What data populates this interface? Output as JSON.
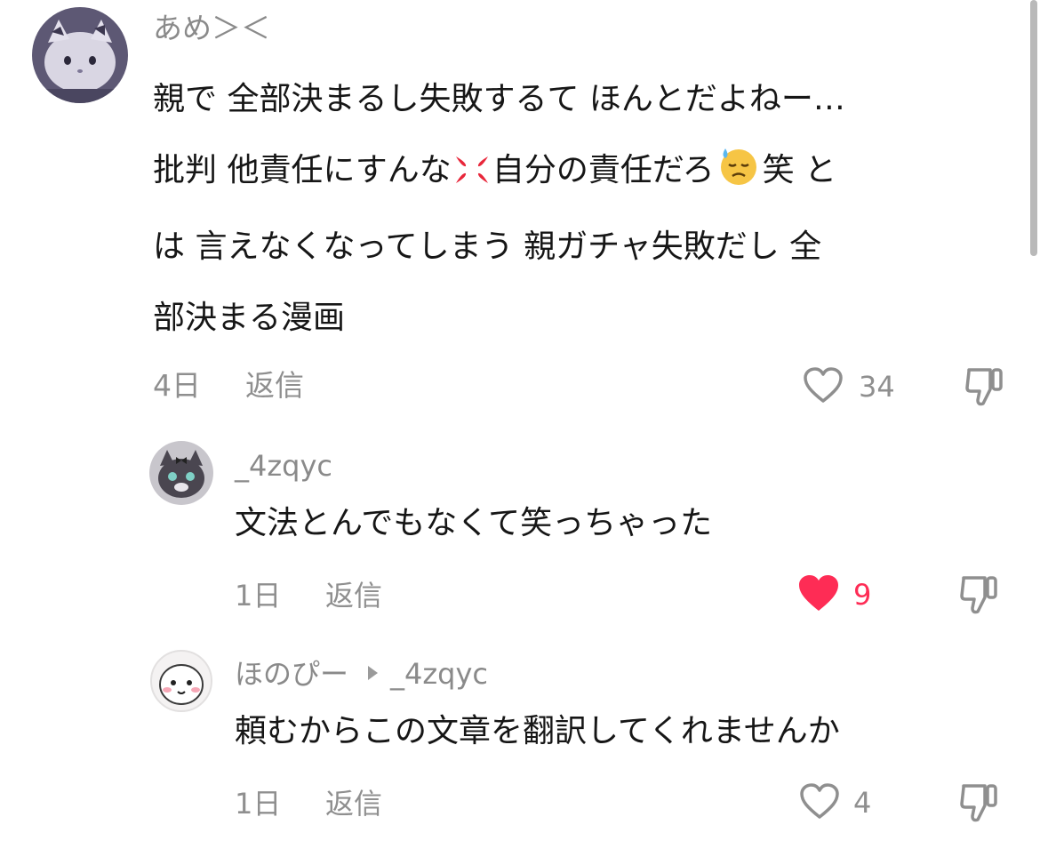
{
  "comments": [
    {
      "username": "あめ＞＜",
      "text_parts": [
        "親で 全部決まるし失敗するて ほんとだよねー…",
        "批判 他責任にすんな",
        "自分の責任だろ",
        "笑 と",
        "は 言えなくなってしまう 親ガチャ失敗だし 全",
        "部決まる漫画"
      ],
      "emojis": [
        "anger-symbol",
        "downcast-face-with-sweat"
      ],
      "time": "4日",
      "reply_label": "返信",
      "likes": "34",
      "liked": false
    },
    {
      "username": "_4zqyc",
      "text": "文法とんでもなくて笑っちゃった",
      "time": "1日",
      "reply_label": "返信",
      "likes": "9",
      "liked": true
    },
    {
      "username": "ほのぴー",
      "reply_to": "_4zqyc",
      "text": "頼むからこの文章を翻訳してくれませんか",
      "time": "1日",
      "reply_label": "返信",
      "likes": "4",
      "liked": false
    }
  ],
  "colors": {
    "liked_heart": "#fe2c55",
    "muted_text": "#8f8f8f",
    "body_text": "#161616"
  }
}
